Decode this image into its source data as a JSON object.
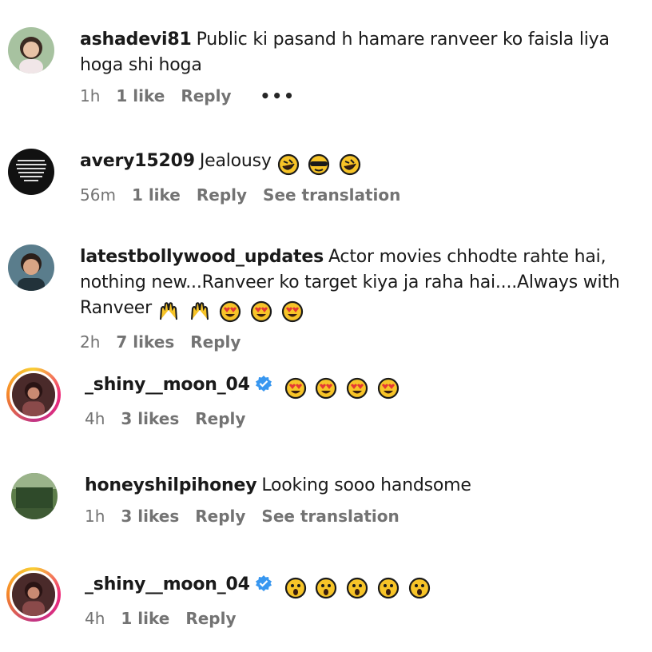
{
  "comments": [
    {
      "user": "ashadevi81",
      "text": "Public ki pasand h hamare ranveer ko faisla liya hoga shi hoga",
      "emojis": [],
      "time": "1h",
      "likes": "1 like",
      "reply": "Reply",
      "more": "•••",
      "verified": false,
      "story_ring": false,
      "avatar": "woman-portrait"
    },
    {
      "user": "avery15209",
      "text": "Jealousy",
      "emojis": [
        "rolling-laughing",
        "sunglasses",
        "rolling-laughing"
      ],
      "time": "56m",
      "likes": "1 like",
      "reply": "Reply",
      "translation": "See translation",
      "verified": false,
      "story_ring": false,
      "avatar": "text-image"
    },
    {
      "user": "latestbollywood_updates",
      "text": "Actor movies chhodte rahte hai, nothing new...Ranveer ko target kiya ja raha hai....Always with Ranveer",
      "emojis": [
        "raising-hands",
        "raising-hands",
        "heart-eyes",
        "heart-eyes",
        "heart-eyes"
      ],
      "time": "2h",
      "likes": "7 likes",
      "reply": "Reply",
      "verified": false,
      "story_ring": false,
      "avatar": "man-portrait"
    },
    {
      "user": "_shiny__moon_04",
      "text": "",
      "emojis": [
        "heart-eyes",
        "heart-eyes",
        "heart-eyes",
        "heart-eyes"
      ],
      "time": "4h",
      "likes": "3 likes",
      "reply": "Reply",
      "verified": true,
      "story_ring": true,
      "avatar": "woman-dark"
    },
    {
      "user": "honeyshilpihoney",
      "text": "Looking sooo handsome",
      "emojis": [],
      "time": "1h",
      "likes": "3 likes",
      "reply": "Reply",
      "translation": "See translation",
      "verified": false,
      "story_ring": false,
      "avatar": "landscape"
    },
    {
      "user": "_shiny__moon_04",
      "text": "",
      "emojis": [
        "astonished",
        "astonished",
        "astonished",
        "astonished",
        "astonished"
      ],
      "time": "4h",
      "likes": "1 like",
      "reply": "Reply",
      "verified": true,
      "story_ring": true,
      "avatar": "woman-dark"
    }
  ],
  "colors": {
    "verified": "#3897f0",
    "meta": "#737373",
    "ring_gradient": [
      "#f9ce34",
      "#ee2a7b",
      "#c13584"
    ]
  }
}
